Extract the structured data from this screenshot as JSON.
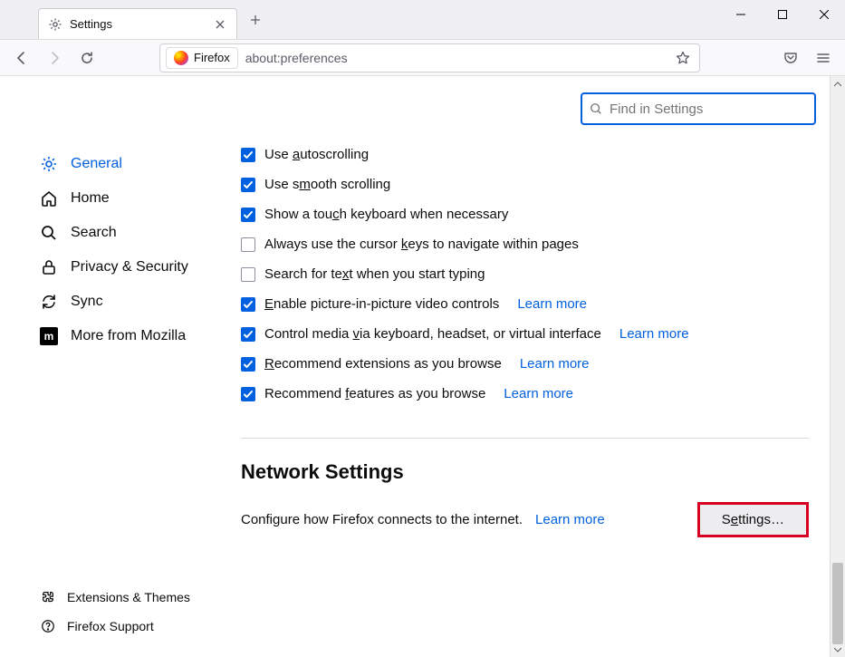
{
  "tab": {
    "title": "Settings"
  },
  "urlbar": {
    "identity": "Firefox",
    "url": "about:preferences"
  },
  "search": {
    "placeholder": "Find in Settings"
  },
  "sidebar": {
    "items": [
      {
        "label": "General"
      },
      {
        "label": "Home"
      },
      {
        "label": "Search"
      },
      {
        "label": "Privacy & Security"
      },
      {
        "label": "Sync"
      },
      {
        "label": "More from Mozilla"
      }
    ],
    "footer": [
      {
        "label": "Extensions & Themes"
      },
      {
        "label": "Firefox Support"
      }
    ]
  },
  "browsing": {
    "items": [
      {
        "checked": true,
        "pre": "Use ",
        "u": "a",
        "post": "utoscrolling",
        "learn": null
      },
      {
        "checked": true,
        "pre": "Use s",
        "u": "m",
        "post": "ooth scrolling",
        "learn": null
      },
      {
        "checked": true,
        "pre": "Show a tou",
        "u": "c",
        "post": "h keyboard when necessary",
        "learn": null
      },
      {
        "checked": false,
        "pre": "Always use the cursor ",
        "u": "k",
        "post": "eys to navigate within pages",
        "learn": null
      },
      {
        "checked": false,
        "pre": "Search for te",
        "u": "x",
        "post": "t when you start typing",
        "learn": null
      },
      {
        "checked": true,
        "pre": "",
        "u": "E",
        "post": "nable picture-in-picture video controls",
        "learn": "Learn more"
      },
      {
        "checked": true,
        "pre": "Control media ",
        "u": "v",
        "post": "ia keyboard, headset, or virtual interface",
        "learn": "Learn more"
      },
      {
        "checked": true,
        "pre": "",
        "u": "R",
        "post": "ecommend extensions as you browse",
        "learn": "Learn more"
      },
      {
        "checked": true,
        "pre": "Recommend ",
        "u": "f",
        "post": "eatures as you browse",
        "learn": "Learn more"
      }
    ]
  },
  "network": {
    "title": "Network Settings",
    "desc": "Configure how Firefox connects to the internet.",
    "learn": "Learn more",
    "button_pre": "S",
    "button_u": "e",
    "button_post": "ttings…"
  }
}
